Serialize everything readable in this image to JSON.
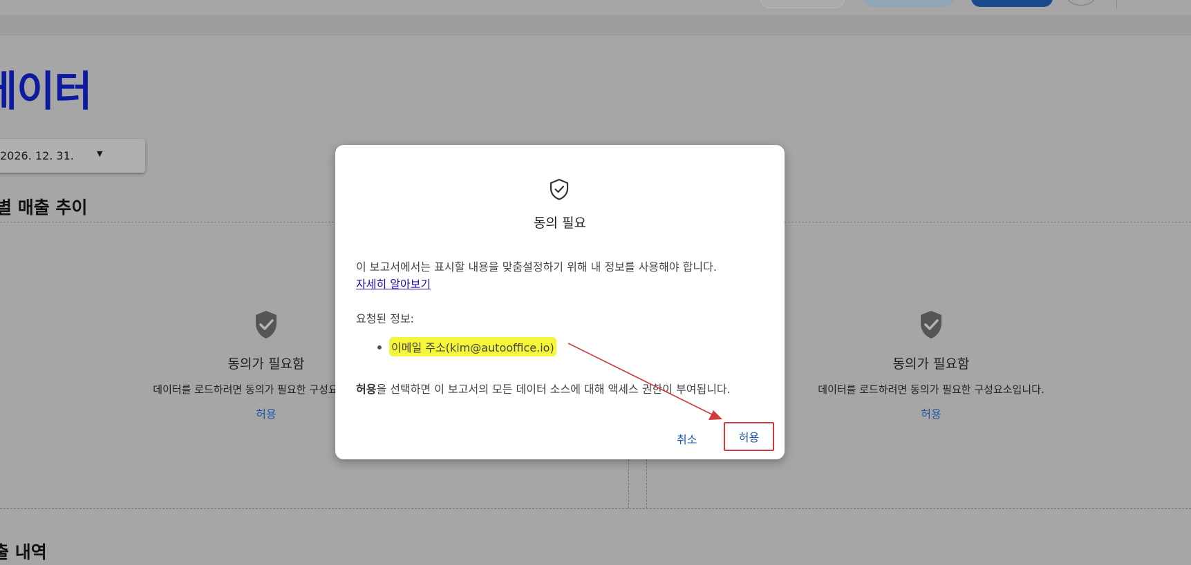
{
  "page": {
    "title": "데이터",
    "date_value": "2026. 12. 31.",
    "section1_title": "별 매출 추이",
    "section2_title": "출 내역"
  },
  "cards": [
    {
      "title": "동의가 필요함",
      "desc": "데이터를 로드하려면 동의가 필요한 구성요소입니다.",
      "allow": "허용"
    },
    {
      "title": "동의가 필요함",
      "desc": "데이터를 로드하려면 동의가 필요한 구성요소입니다.",
      "allow": "허용"
    }
  ],
  "dialog": {
    "title": "동의 필요",
    "text": "이 보고서에서는 표시할 내용을 맞춤설정하기 위해 내 정보를 사용해야 합니다.",
    "learn_more": "자세히 알아보기",
    "requested_label": "요청된 정보:",
    "requested_items": [
      "이메일 주소(kim@autooffice.io)"
    ],
    "note_bold": "허용",
    "note_rest": "을 선택하면 이 보고서의 모든 데이터 소스에 대해 액세스 권한이 부여됩니다.",
    "cancel_label": "취소",
    "allow_label": "허용"
  },
  "icons": {
    "dialog_icon": "shield-check-outline-icon",
    "card_icon": "shield-check-icon",
    "dropdown_icon": "caret-down-icon"
  },
  "colors": {
    "link": "#1f58a6",
    "title": "#0c1ba0",
    "highlight": "#f5f53a",
    "annotation": "#d03a3a"
  }
}
